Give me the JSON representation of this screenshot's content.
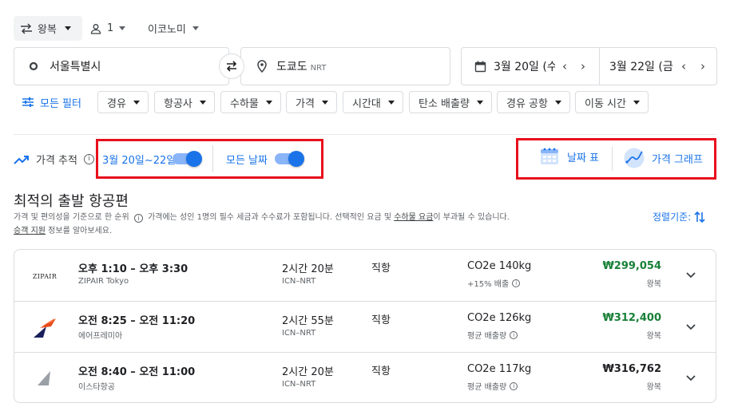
{
  "header": {
    "trip_type": "왕복",
    "passengers": "1",
    "cabin_class": "이코노미"
  },
  "search": {
    "origin": "서울특별시",
    "destination": "도쿄도",
    "destination_code": "NRT",
    "depart_date": "3월 20일 (수)",
    "return_date": "3월 22일 (금)"
  },
  "filters": {
    "all_filters_label": "모든 필터",
    "chips": [
      "경유",
      "항공사",
      "수하물",
      "가격",
      "시간대",
      "탄소 배출량",
      "경유 공항",
      "이동 시간"
    ]
  },
  "tracking": {
    "label": "가격 추적",
    "date_range_label": "3월 20일~22일",
    "all_dates_label": "모든 날짜",
    "date_grid_label": "날짜 표",
    "price_graph_label": "가격 그래프"
  },
  "results_section": {
    "title": "최적의 출발 항공편",
    "subtitle_1": "가격 및 편의성을 기준으로 한 순위",
    "subtitle_2": "가격에는 성인 1명의 필수 세금과 수수료가 포함됩니다. 선택적인 요금 및",
    "subtitle_link_1": "수하물 요금",
    "subtitle_3": "이 부과될 수 있습니다.",
    "subtitle_link_2": "승객 지원",
    "subtitle_4": "정보를 알아보세요.",
    "sort_label": "정렬기준:"
  },
  "flights": [
    {
      "logo": "ZIPAIR",
      "times": "오후 1:10 – 오후 3:30",
      "airline": "ZIPAIR Tokyo",
      "duration": "2시간 20분",
      "route": "ICN–NRT",
      "stops": "직항",
      "co2": "CO2e 140kg",
      "emissions": "+15% 배출",
      "price": "₩299,054",
      "price_type": "왕복",
      "price_color": "#188038"
    },
    {
      "logo": "air-premia-logo",
      "times": "오전 8:25 – 오전 11:20",
      "airline": "에어프레미아",
      "duration": "2시간 55분",
      "route": "ICN–NRT",
      "stops": "직항",
      "co2": "CO2e 126kg",
      "emissions": "평균 배출량",
      "price": "₩312,400",
      "price_type": "왕복",
      "price_color": "#188038"
    },
    {
      "logo": "eastar-jet-logo",
      "times": "오전 8:40 – 오전 11:00",
      "airline": "이스타항공",
      "duration": "2시간 20분",
      "route": "ICN–NRT",
      "stops": "직항",
      "co2": "CO2e 117kg",
      "emissions": "평균 배출량",
      "price": "₩316,762",
      "price_type": "왕복",
      "price_color": "#202124"
    }
  ],
  "colors": {
    "accent": "#1a73e8",
    "highlight_box": "#e8101c",
    "price_green": "#188038"
  }
}
